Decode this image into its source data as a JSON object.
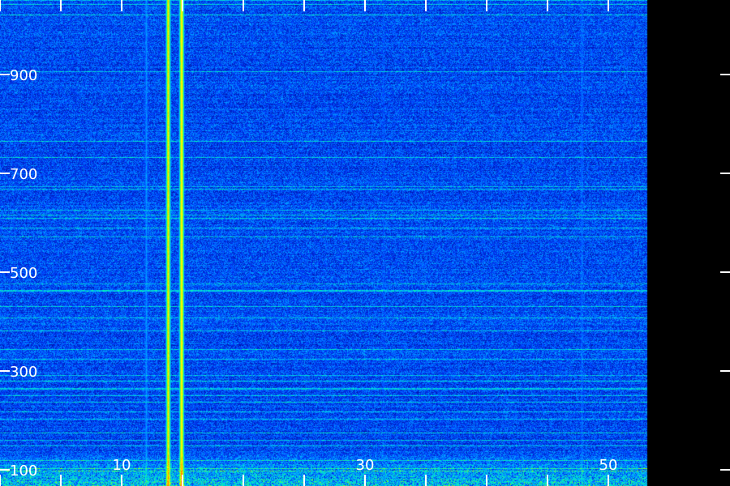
{
  "chart_data": {
    "type": "heatmap",
    "title": "",
    "xlabel": "",
    "ylabel": "",
    "x_tick_labels": [
      "10",
      "30",
      "50"
    ],
    "x_tick_values": [
      10,
      30,
      50
    ],
    "y_tick_labels": [
      "900",
      "700",
      "500",
      "300",
      "100"
    ],
    "y_tick_values": [
      900,
      700,
      500,
      300,
      100
    ],
    "xlim": [
      0,
      53
    ],
    "ylim": [
      100,
      1100
    ],
    "colormap": [
      "#000040",
      "#0010a0",
      "#0040ff",
      "#00b0ff",
      "#00ffb0",
      "#a0ff00",
      "#ffff00",
      "#ff8000"
    ],
    "background_color": "#000000",
    "label_color": "#ffffff",
    "series": [
      {
        "x": 13.8,
        "intensity": 0.85
      },
      {
        "x": 14.9,
        "intensity": 0.9
      },
      {
        "x": 12.0,
        "intensity": 0.35
      },
      {
        "x": 31.5,
        "intensity": 0.25
      },
      {
        "x": 47.8,
        "intensity": 0.3
      }
    ]
  }
}
